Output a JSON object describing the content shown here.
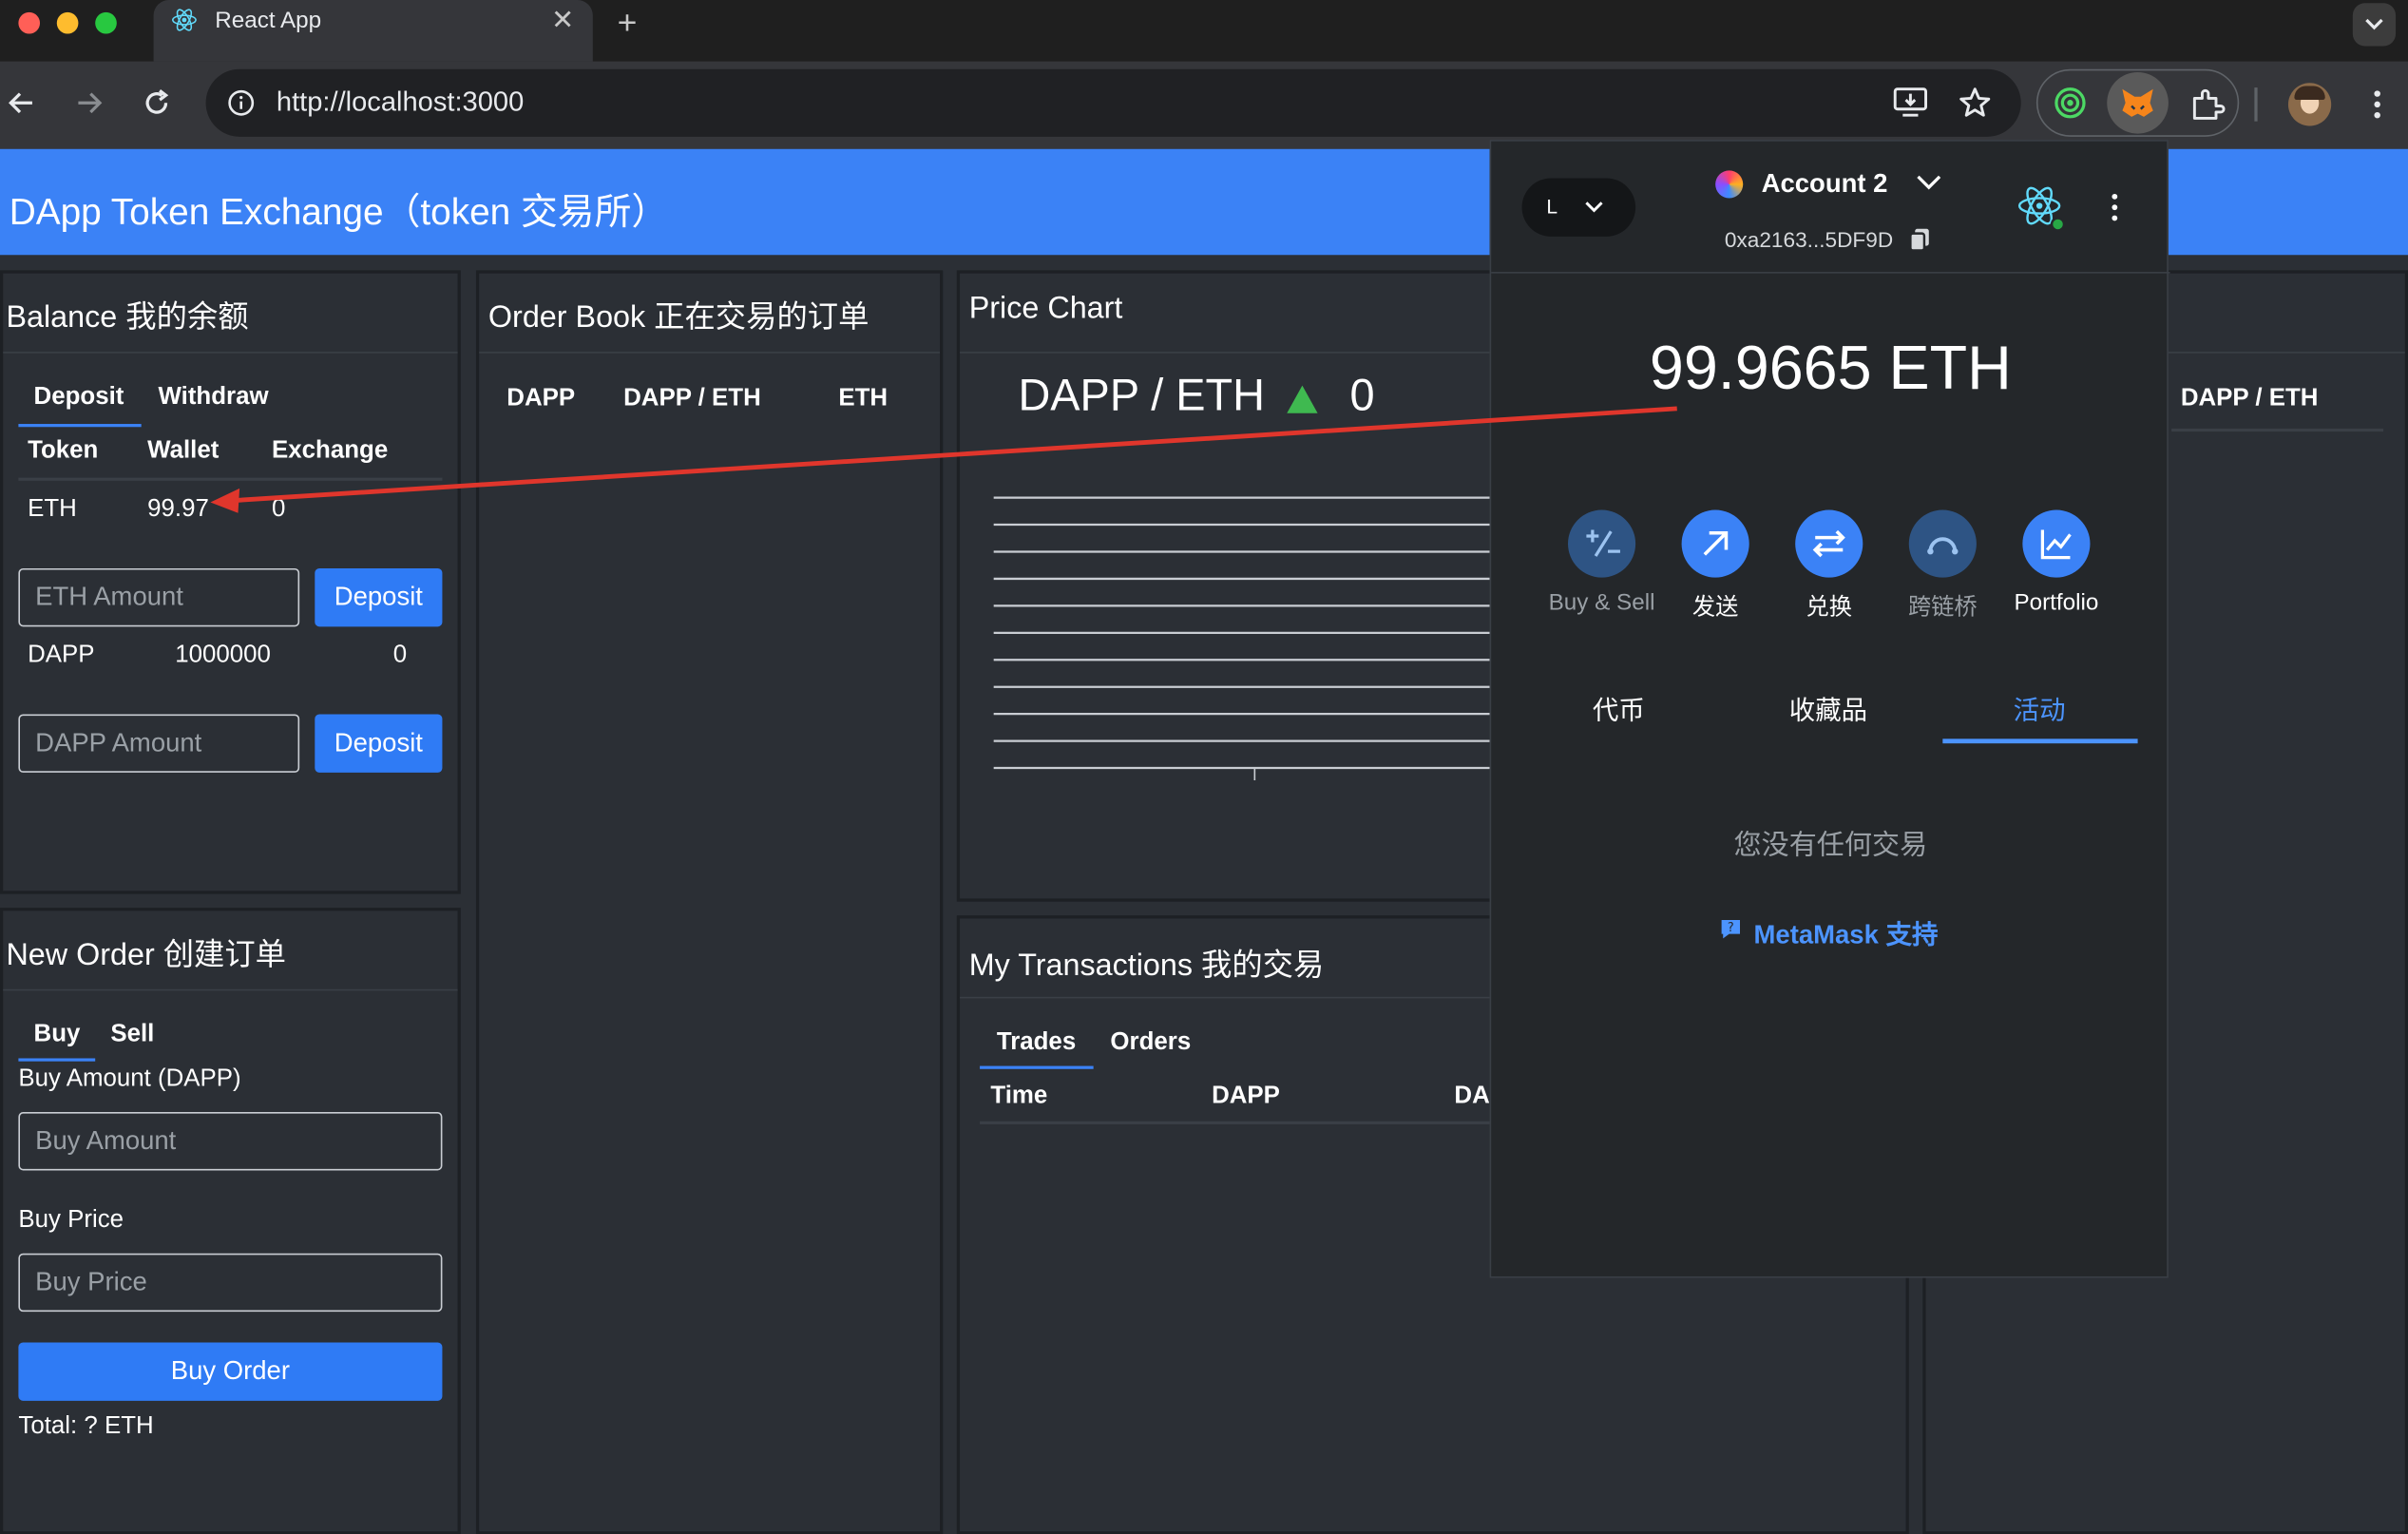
{
  "browser": {
    "tab_title": "React App",
    "url": "http://localhost:3000"
  },
  "app": {
    "title": "DApp Token Exchange（token 交易所）"
  },
  "balance": {
    "title": "Balance 我的余额",
    "tabs": [
      "Deposit",
      "Withdraw"
    ],
    "columns": [
      "Token",
      "Wallet",
      "Exchange"
    ],
    "eth_row": {
      "token": "ETH",
      "wallet": "99.97",
      "exchange": "0"
    },
    "eth_placeholder": "ETH Amount",
    "deposit_label": "Deposit",
    "dapp_row": {
      "token": "DAPP",
      "wallet": "1000000",
      "exchange": "0"
    },
    "dapp_placeholder": "DAPP Amount"
  },
  "new_order": {
    "title": "New Order 创建订单",
    "tabs": [
      "Buy",
      "Sell"
    ],
    "amount_label": "Buy Amount (DAPP)",
    "amount_placeholder": "Buy Amount",
    "price_label": "Buy Price",
    "price_placeholder": "Buy Price",
    "submit_label": "Buy Order",
    "total": "Total: ? ETH"
  },
  "order_book": {
    "title": "Order Book 正在交易的订单",
    "columns": [
      "DAPP",
      "DAPP / ETH",
      "ETH"
    ]
  },
  "price_chart": {
    "title": "Price Chart",
    "pair": "DAPP / ETH",
    "price": "0",
    "trend_color": "#3fb950"
  },
  "my_transactions": {
    "title": "My Transactions 我的交易",
    "tabs": [
      "Trades",
      "Orders"
    ],
    "columns": [
      "Time",
      "DAPP",
      "DA"
    ]
  },
  "right_panel": {
    "column": "DAPP / ETH"
  },
  "metamask": {
    "network_label": "L",
    "account_name": "Account 2",
    "address": "0xa2163...5DF9D",
    "balance": "99.9665 ETH",
    "actions": [
      {
        "label": "Buy & Sell",
        "icon": "buy-sell-icon"
      },
      {
        "label": "发送",
        "icon": "send-icon"
      },
      {
        "label": "兑换",
        "icon": "swap-icon"
      },
      {
        "label": "跨链桥",
        "icon": "bridge-icon"
      },
      {
        "label": "Portfolio",
        "icon": "portfolio-icon"
      }
    ],
    "tabs": [
      "代币",
      "收藏品",
      "活动"
    ],
    "empty_text": "您没有任何交易",
    "support_link": "MetaMask 支持"
  },
  "colors": {
    "app_header": "#3b82f6",
    "panel_bg": "#2b2f35",
    "accent": "#3b82f6",
    "annotation_arrow": "#e0362c"
  }
}
